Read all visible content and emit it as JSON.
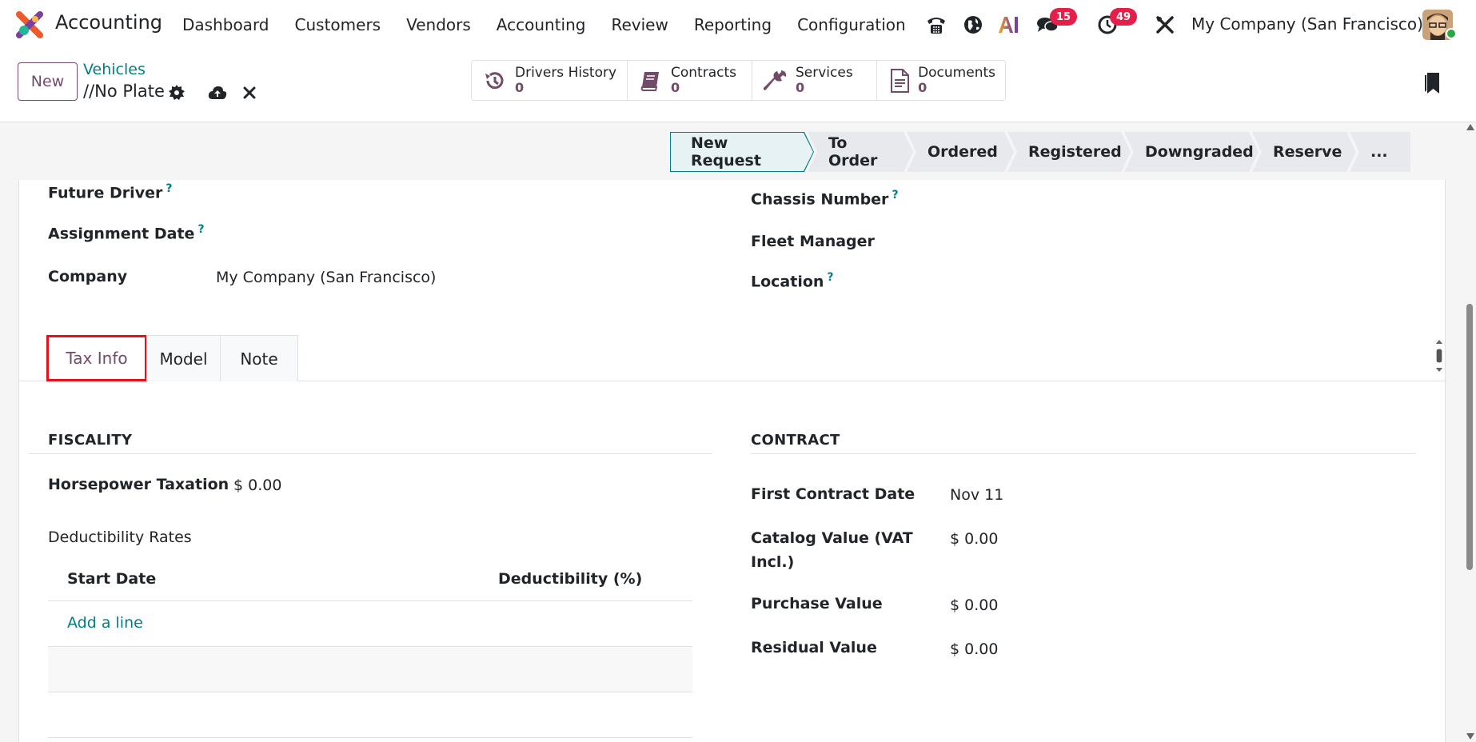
{
  "app": {
    "name": "Accounting",
    "accent": "#714b67",
    "link_color": "#017e84"
  },
  "menu": [
    "Dashboard",
    "Customers",
    "Vendors",
    "Accounting",
    "Review",
    "Reporting",
    "Configuration"
  ],
  "systray": {
    "phone_icon": "phone-icon",
    "globe_icon": "globe-icon",
    "ai_icon": "ai-icon",
    "messages_badge": "15",
    "activities_badge": "49",
    "tools_icon": "tools-icon",
    "company": "My Company (San Francisco)"
  },
  "control_panel": {
    "new_label": "New",
    "breadcrumb": "Vehicles",
    "record_name": "//No Plate",
    "smart_buttons": [
      {
        "label": "Drivers History",
        "value": "0",
        "icon": "history-icon"
      },
      {
        "label": "Contracts",
        "value": "0",
        "icon": "book-icon"
      },
      {
        "label": "Services",
        "value": "0",
        "icon": "wrench-icon"
      },
      {
        "label": "Documents",
        "value": "0",
        "icon": "document-icon"
      }
    ]
  },
  "statusbar": {
    "stages": [
      "New Request",
      "To Order",
      "Ordered",
      "Registered",
      "Downgraded",
      "Reserve",
      "..."
    ],
    "active": "New Request"
  },
  "form": {
    "left": {
      "future_driver_label": "Future Driver",
      "assignment_date_label": "Assignment Date",
      "company_label": "Company",
      "company_value": "My Company (San Francisco)"
    },
    "right": {
      "chassis_label": "Chassis Number",
      "fleet_manager_label": "Fleet Manager",
      "location_label": "Location"
    },
    "help_marker": "?"
  },
  "tabs": [
    "Tax Info",
    "Model",
    "Note"
  ],
  "tax_info": {
    "fiscality_title": "FISCALITY",
    "horsepower_label": "Horsepower Taxation",
    "horsepower_value": "$ 0.00",
    "deductibility_label": "Deductibility Rates",
    "table_headers": [
      "Start Date",
      "Deductibility (%)"
    ],
    "add_line": "Add a line",
    "contract_title": "CONTRACT",
    "first_contract_label": "First Contract Date",
    "first_contract_value": "Nov 11",
    "catalog_label_1": "Catalog Value (VAT",
    "catalog_label_2": "Incl.)",
    "catalog_value": "$ 0.00",
    "purchase_label": "Purchase Value",
    "purchase_value": "$ 0.00",
    "residual_label": "Residual Value",
    "residual_value": "$ 0.00"
  }
}
